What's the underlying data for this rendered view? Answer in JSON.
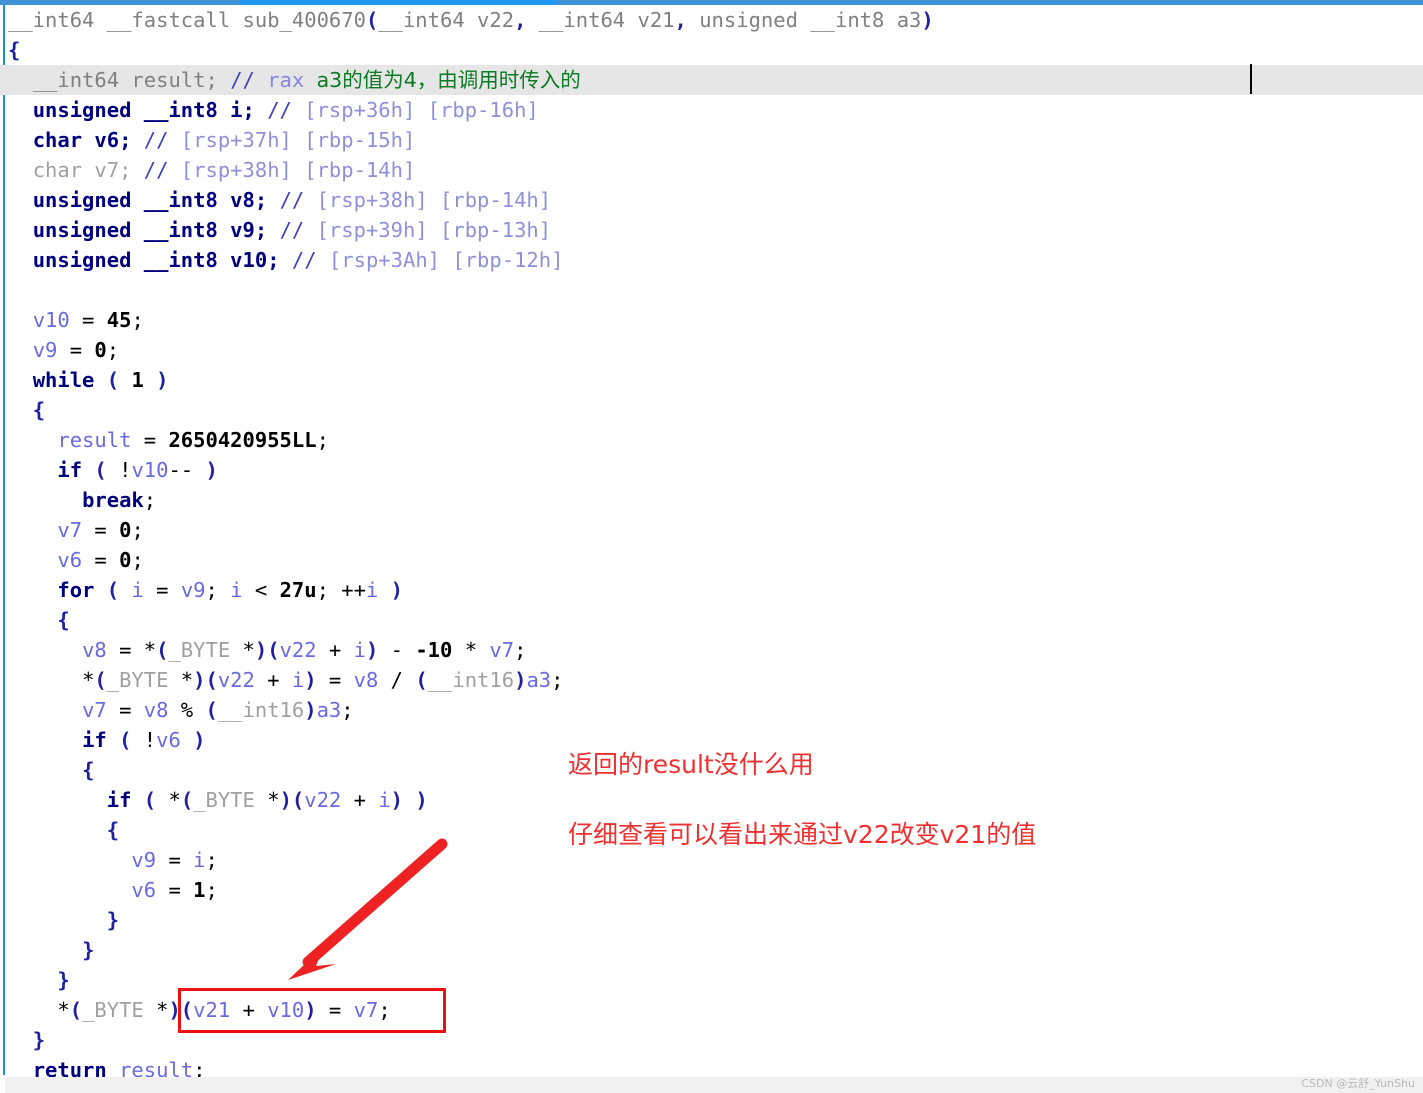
{
  "window": {
    "kind": "ida-pro-pseudocode-view",
    "accent_color": "#2196f3",
    "border_color": "#3f93d4",
    "highlight_row_color": "#e6e6e6",
    "annotation_color": "#f03030",
    "comment_chinese_color": "#0a7a22"
  },
  "code": {
    "language": "C pseudocode",
    "function_name": "sub_400670",
    "highlighted_line_index": 2,
    "lines": [
      {
        "indent": 0,
        "tokens": [
          {
            "t": "__int64",
            "c": "t-type-d"
          },
          {
            "t": " ",
            "c": "t-op"
          },
          {
            "t": "__fastcall",
            "c": "t-type-d"
          },
          {
            "t": " ",
            "c": "t-op"
          },
          {
            "t": "sub_400670",
            "c": "t-type-d"
          },
          {
            "t": "(",
            "c": "t-punc"
          },
          {
            "t": "__int64",
            "c": "t-type-d"
          },
          {
            "t": " v22",
            "c": "t-type-d"
          },
          {
            "t": ", ",
            "c": "t-punc"
          },
          {
            "t": "__int64",
            "c": "t-type-d"
          },
          {
            "t": " v21",
            "c": "t-type-d"
          },
          {
            "t": ", ",
            "c": "t-punc"
          },
          {
            "t": "unsigned",
            "c": "t-type-d"
          },
          {
            "t": " ",
            "c": "t-op"
          },
          {
            "t": "__int8",
            "c": "t-type-d"
          },
          {
            "t": " a3",
            "c": "t-type-d"
          },
          {
            "t": ")",
            "c": "t-punc"
          }
        ]
      },
      {
        "indent": 0,
        "tokens": [
          {
            "t": "{",
            "c": "t-punc"
          }
        ]
      },
      {
        "indent": 1,
        "highlight": true,
        "tokens": [
          {
            "t": "__int64",
            "c": "t-type-d"
          },
          {
            "t": " result;",
            "c": "t-type-d"
          },
          {
            "t": " ",
            "c": "t-op"
          },
          {
            "t": "//",
            "c": "t-cmt"
          },
          {
            "t": " ",
            "c": "t-op"
          },
          {
            "t": "rax",
            "c": "t-reg"
          },
          {
            "t": " ",
            "c": "t-op"
          },
          {
            "t": "a3的值为4，由调用时传入的",
            "c": "t-zh"
          }
        ]
      },
      {
        "indent": 1,
        "tokens": [
          {
            "t": "unsigned",
            "c": "t-kw"
          },
          {
            "t": " ",
            "c": "t-op"
          },
          {
            "t": "__int8",
            "c": "t-kw"
          },
          {
            "t": " i;",
            "c": "t-kw"
          },
          {
            "t": " ",
            "c": "t-op"
          },
          {
            "t": "//",
            "c": "t-cmt"
          },
          {
            "t": " [rsp+36h] [rbp-16h]",
            "c": "t-cmt-dim"
          }
        ]
      },
      {
        "indent": 1,
        "tokens": [
          {
            "t": "char",
            "c": "t-kw"
          },
          {
            "t": " v6;",
            "c": "t-kw"
          },
          {
            "t": " ",
            "c": "t-op"
          },
          {
            "t": "//",
            "c": "t-cmt"
          },
          {
            "t": " [rsp+37h] [rbp-15h]",
            "c": "t-cmt-dim"
          }
        ]
      },
      {
        "indent": 1,
        "tokens": [
          {
            "t": "char",
            "c": "t-dim"
          },
          {
            "t": " v7;",
            "c": "t-dim"
          },
          {
            "t": " ",
            "c": "t-op"
          },
          {
            "t": "//",
            "c": "t-cmt"
          },
          {
            "t": " [rsp+38h] [rbp-14h]",
            "c": "t-cmt-dim"
          }
        ]
      },
      {
        "indent": 1,
        "tokens": [
          {
            "t": "unsigned",
            "c": "t-kw"
          },
          {
            "t": " ",
            "c": "t-op"
          },
          {
            "t": "__int8",
            "c": "t-kw"
          },
          {
            "t": " v8;",
            "c": "t-kw"
          },
          {
            "t": " ",
            "c": "t-op"
          },
          {
            "t": "//",
            "c": "t-cmt"
          },
          {
            "t": " [rsp+38h] [rbp-14h]",
            "c": "t-cmt-dim"
          }
        ]
      },
      {
        "indent": 1,
        "tokens": [
          {
            "t": "unsigned",
            "c": "t-kw"
          },
          {
            "t": " ",
            "c": "t-op"
          },
          {
            "t": "__int8",
            "c": "t-kw"
          },
          {
            "t": " v9;",
            "c": "t-kw"
          },
          {
            "t": " ",
            "c": "t-op"
          },
          {
            "t": "//",
            "c": "t-cmt"
          },
          {
            "t": " [rsp+39h] [rbp-13h]",
            "c": "t-cmt-dim"
          }
        ]
      },
      {
        "indent": 1,
        "tokens": [
          {
            "t": "unsigned",
            "c": "t-kw"
          },
          {
            "t": " ",
            "c": "t-op"
          },
          {
            "t": "__int8",
            "c": "t-kw"
          },
          {
            "t": " v10;",
            "c": "t-kw"
          },
          {
            "t": " ",
            "c": "t-op"
          },
          {
            "t": "//",
            "c": "t-cmt"
          },
          {
            "t": " [rsp+3Ah] [rbp-12h]",
            "c": "t-cmt-dim"
          }
        ]
      },
      {
        "indent": 0,
        "tokens": []
      },
      {
        "indent": 1,
        "tokens": [
          {
            "t": "v10",
            "c": "t-var"
          },
          {
            "t": " = ",
            "c": "t-op"
          },
          {
            "t": "45",
            "c": "t-num"
          },
          {
            "t": ";",
            "c": "t-op"
          }
        ]
      },
      {
        "indent": 1,
        "tokens": [
          {
            "t": "v9",
            "c": "t-var"
          },
          {
            "t": " = ",
            "c": "t-op"
          },
          {
            "t": "0",
            "c": "t-num"
          },
          {
            "t": ";",
            "c": "t-op"
          }
        ]
      },
      {
        "indent": 1,
        "tokens": [
          {
            "t": "while",
            "c": "t-kw"
          },
          {
            "t": " ( ",
            "c": "t-punc"
          },
          {
            "t": "1",
            "c": "t-num"
          },
          {
            "t": " )",
            "c": "t-punc"
          }
        ]
      },
      {
        "indent": 1,
        "tokens": [
          {
            "t": "{",
            "c": "t-punc"
          }
        ]
      },
      {
        "indent": 2,
        "tokens": [
          {
            "t": "result",
            "c": "t-var"
          },
          {
            "t": " = ",
            "c": "t-op"
          },
          {
            "t": "2650420955LL",
            "c": "t-num"
          },
          {
            "t": ";",
            "c": "t-op"
          }
        ]
      },
      {
        "indent": 2,
        "tokens": [
          {
            "t": "if",
            "c": "t-kw"
          },
          {
            "t": " ( ",
            "c": "t-punc"
          },
          {
            "t": "!",
            "c": "t-op"
          },
          {
            "t": "v10",
            "c": "t-var"
          },
          {
            "t": "--",
            "c": "t-op"
          },
          {
            "t": " )",
            "c": "t-punc"
          }
        ]
      },
      {
        "indent": 3,
        "tokens": [
          {
            "t": "break",
            "c": "t-kw"
          },
          {
            "t": ";",
            "c": "t-op"
          }
        ]
      },
      {
        "indent": 2,
        "tokens": [
          {
            "t": "v7",
            "c": "t-var"
          },
          {
            "t": " = ",
            "c": "t-op"
          },
          {
            "t": "0",
            "c": "t-num"
          },
          {
            "t": ";",
            "c": "t-op"
          }
        ]
      },
      {
        "indent": 2,
        "tokens": [
          {
            "t": "v6",
            "c": "t-var"
          },
          {
            "t": " = ",
            "c": "t-op"
          },
          {
            "t": "0",
            "c": "t-num"
          },
          {
            "t": ";",
            "c": "t-op"
          }
        ]
      },
      {
        "indent": 2,
        "tokens": [
          {
            "t": "for",
            "c": "t-kw"
          },
          {
            "t": " ( ",
            "c": "t-punc"
          },
          {
            "t": "i",
            "c": "t-var"
          },
          {
            "t": " = ",
            "c": "t-op"
          },
          {
            "t": "v9",
            "c": "t-var"
          },
          {
            "t": "; ",
            "c": "t-op"
          },
          {
            "t": "i",
            "c": "t-var"
          },
          {
            "t": " < ",
            "c": "t-op"
          },
          {
            "t": "27u",
            "c": "t-num"
          },
          {
            "t": "; ",
            "c": "t-op"
          },
          {
            "t": "++",
            "c": "t-op"
          },
          {
            "t": "i",
            "c": "t-var"
          },
          {
            "t": " )",
            "c": "t-punc"
          }
        ]
      },
      {
        "indent": 2,
        "tokens": [
          {
            "t": "{",
            "c": "t-punc"
          }
        ]
      },
      {
        "indent": 3,
        "tokens": [
          {
            "t": "v8",
            "c": "t-var"
          },
          {
            "t": " = ",
            "c": "t-op"
          },
          {
            "t": "*",
            "c": "t-op"
          },
          {
            "t": "(",
            "c": "t-punc"
          },
          {
            "t": "_BYTE",
            "c": "t-dim"
          },
          {
            "t": " *",
            "c": "t-op"
          },
          {
            "t": ")(",
            "c": "t-punc"
          },
          {
            "t": "v22",
            "c": "t-var"
          },
          {
            "t": " + ",
            "c": "t-op"
          },
          {
            "t": "i",
            "c": "t-var"
          },
          {
            "t": ")",
            "c": "t-punc"
          },
          {
            "t": " - ",
            "c": "t-op"
          },
          {
            "t": "-10",
            "c": "t-num"
          },
          {
            "t": " * ",
            "c": "t-op"
          },
          {
            "t": "v7",
            "c": "t-var"
          },
          {
            "t": ";",
            "c": "t-op"
          }
        ]
      },
      {
        "indent": 3,
        "tokens": [
          {
            "t": "*",
            "c": "t-op"
          },
          {
            "t": "(",
            "c": "t-punc"
          },
          {
            "t": "_BYTE",
            "c": "t-dim"
          },
          {
            "t": " *",
            "c": "t-op"
          },
          {
            "t": ")(",
            "c": "t-punc"
          },
          {
            "t": "v22",
            "c": "t-var"
          },
          {
            "t": " + ",
            "c": "t-op"
          },
          {
            "t": "i",
            "c": "t-var"
          },
          {
            "t": ")",
            "c": "t-punc"
          },
          {
            "t": " = ",
            "c": "t-op"
          },
          {
            "t": "v8",
            "c": "t-var"
          },
          {
            "t": " / ",
            "c": "t-op"
          },
          {
            "t": "(",
            "c": "t-punc"
          },
          {
            "t": "__int16",
            "c": "t-dim"
          },
          {
            "t": ")",
            "c": "t-punc"
          },
          {
            "t": "a3",
            "c": "t-var"
          },
          {
            "t": ";",
            "c": "t-op"
          }
        ]
      },
      {
        "indent": 3,
        "tokens": [
          {
            "t": "v7",
            "c": "t-var"
          },
          {
            "t": " = ",
            "c": "t-op"
          },
          {
            "t": "v8",
            "c": "t-var"
          },
          {
            "t": " % ",
            "c": "t-op"
          },
          {
            "t": "(",
            "c": "t-punc"
          },
          {
            "t": "__int16",
            "c": "t-dim"
          },
          {
            "t": ")",
            "c": "t-punc"
          },
          {
            "t": "a3",
            "c": "t-var"
          },
          {
            "t": ";",
            "c": "t-op"
          }
        ]
      },
      {
        "indent": 3,
        "tokens": [
          {
            "t": "if",
            "c": "t-kw"
          },
          {
            "t": " ( ",
            "c": "t-punc"
          },
          {
            "t": "!",
            "c": "t-op"
          },
          {
            "t": "v6",
            "c": "t-var"
          },
          {
            "t": " )",
            "c": "t-punc"
          }
        ]
      },
      {
        "indent": 3,
        "tokens": [
          {
            "t": "{",
            "c": "t-punc"
          }
        ]
      },
      {
        "indent": 4,
        "tokens": [
          {
            "t": "if",
            "c": "t-kw"
          },
          {
            "t": " ( ",
            "c": "t-punc"
          },
          {
            "t": "*",
            "c": "t-op"
          },
          {
            "t": "(",
            "c": "t-punc"
          },
          {
            "t": "_BYTE",
            "c": "t-dim"
          },
          {
            "t": " *",
            "c": "t-op"
          },
          {
            "t": ")(",
            "c": "t-punc"
          },
          {
            "t": "v22",
            "c": "t-var"
          },
          {
            "t": " + ",
            "c": "t-op"
          },
          {
            "t": "i",
            "c": "t-var"
          },
          {
            "t": ")",
            "c": "t-punc"
          },
          {
            "t": " )",
            "c": "t-punc"
          }
        ]
      },
      {
        "indent": 4,
        "tokens": [
          {
            "t": "{",
            "c": "t-punc"
          }
        ]
      },
      {
        "indent": 5,
        "tokens": [
          {
            "t": "v9",
            "c": "t-var"
          },
          {
            "t": " = ",
            "c": "t-op"
          },
          {
            "t": "i",
            "c": "t-var"
          },
          {
            "t": ";",
            "c": "t-op"
          }
        ]
      },
      {
        "indent": 5,
        "tokens": [
          {
            "t": "v6",
            "c": "t-var"
          },
          {
            "t": " = ",
            "c": "t-op"
          },
          {
            "t": "1",
            "c": "t-num"
          },
          {
            "t": ";",
            "c": "t-op"
          }
        ]
      },
      {
        "indent": 4,
        "tokens": [
          {
            "t": "}",
            "c": "t-punc"
          }
        ]
      },
      {
        "indent": 3,
        "tokens": [
          {
            "t": "}",
            "c": "t-punc"
          }
        ]
      },
      {
        "indent": 2,
        "tokens": [
          {
            "t": "}",
            "c": "t-punc"
          }
        ]
      },
      {
        "indent": 2,
        "tokens": [
          {
            "t": "*",
            "c": "t-op"
          },
          {
            "t": "(",
            "c": "t-punc"
          },
          {
            "t": "_BYTE",
            "c": "t-dim"
          },
          {
            "t": " *",
            "c": "t-op"
          },
          {
            "t": ")(",
            "c": "t-punc"
          },
          {
            "t": "v21",
            "c": "t-var"
          },
          {
            "t": " + ",
            "c": "t-op"
          },
          {
            "t": "v10",
            "c": "t-var"
          },
          {
            "t": ")",
            "c": "t-punc"
          },
          {
            "t": " = ",
            "c": "t-op"
          },
          {
            "t": "v7",
            "c": "t-var"
          },
          {
            "t": ";",
            "c": "t-op"
          }
        ]
      },
      {
        "indent": 1,
        "tokens": [
          {
            "t": "}",
            "c": "t-punc"
          }
        ]
      },
      {
        "indent": 1,
        "tokens": [
          {
            "t": "return",
            "c": "t-kw"
          },
          {
            "t": " ",
            "c": "t-op"
          },
          {
            "t": "result",
            "c": "t-var"
          },
          {
            "t": ";",
            "c": "t-op"
          }
        ]
      }
    ]
  },
  "annotations": [
    {
      "id": "annot-1",
      "text": "返回的result没什么用"
    },
    {
      "id": "annot-2",
      "text": "仔细查看可以看出来通过v22改变v21的值"
    }
  ],
  "watermark": {
    "text": "CSDN @云舒_YunShu"
  }
}
